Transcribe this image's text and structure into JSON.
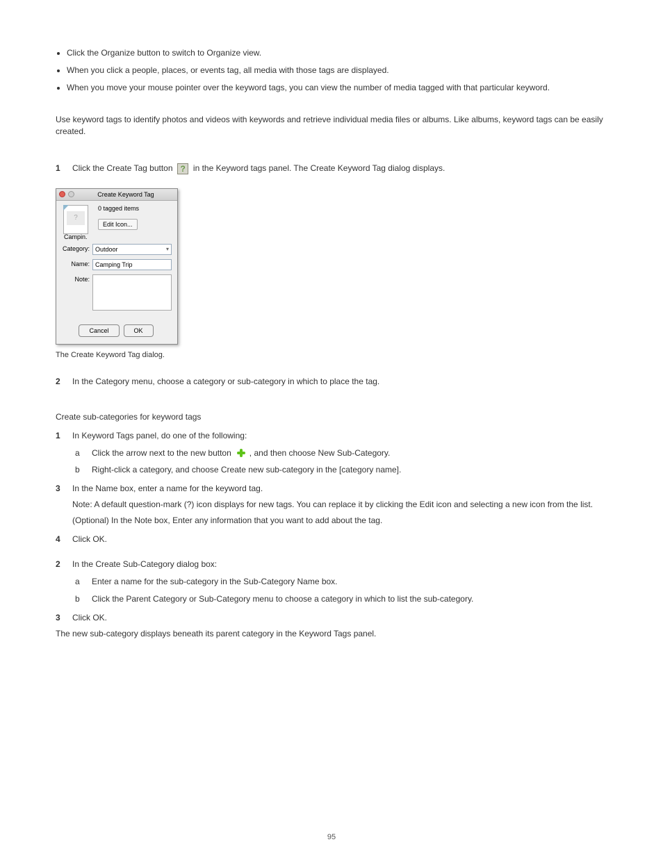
{
  "bullets": [
    "Click the Organize button to switch to Organize view.",
    "When you click a people, places, or events tag, all media with those tags are displayed.",
    "When you move your mouse pointer over the keyword tags, you can view the number of media tagged with that particular keyword."
  ],
  "preamble": "Use keyword tags to identify photos and videos with keywords and retrieve individual media files or albums. Like albums, keyword tags can be easily created.",
  "steps": {
    "s1_a": "Click the Create Tag button ",
    "s1_b": " in the Keyword tags panel. The Create Keyword Tag dialog displays.",
    "s2": "In the Category menu, choose a category or sub-category in which to place the tag.",
    "s3_a": "In the Name box, enter a name for the keyword tag.",
    "note": "Note: A default question-mark (?) icon displays for new tags. You can replace it by clicking the Edit icon and selecting a new icon from the list.",
    "s3_b": "(Optional) In the Note box, Enter any information that you want to add about the tag.",
    "s4": "Click OK."
  },
  "dialog": {
    "title": "Create Keyword Tag",
    "tagged_items": "0 tagged items",
    "preview_label": "Campin...",
    "edit_icon": "Edit Icon...",
    "category_label": "Category:",
    "category_value": "Outdoor",
    "name_label": "Name:",
    "name_value": "Camping Trip",
    "note_label": "Note:",
    "cancel": "Cancel",
    "ok": "OK"
  },
  "caption": "The Create Keyword Tag dialog.",
  "heading2": "Create sub-categories for keyword tags",
  "intro2": "In Keyword Tags panel, do one of the following:",
  "step2a_a": "Click the arrow next to the new button ",
  "step2a_b": ", and then choose New Sub-Category.",
  "step2b": "Right-click a category, and choose Create new sub-category in the [category name].",
  "step2_2_intro": "In the Create Sub-Category dialog box:",
  "step2_2a": "Enter a name for the sub-category in the Sub-Category Name box.",
  "step2_2b": "Click the Parent Category or Sub-Category menu to choose a category in which to list the sub-category.",
  "step2_3": "Click OK.",
  "tail2": "The new sub-category displays beneath its parent category in the Keyword Tags panel.",
  "page_number": "95"
}
